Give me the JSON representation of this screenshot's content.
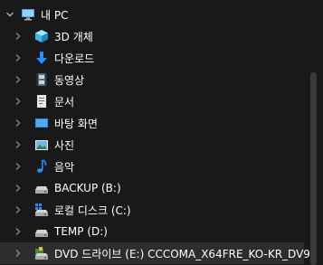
{
  "tree": {
    "root": {
      "label": "내 PC",
      "icon": "this-pc-icon",
      "expanded": true
    },
    "items": [
      {
        "label": "3D 개체",
        "icon": "3d-objects-icon"
      },
      {
        "label": "다운로드",
        "icon": "downloads-icon"
      },
      {
        "label": "동영상",
        "icon": "videos-icon"
      },
      {
        "label": "문서",
        "icon": "documents-icon"
      },
      {
        "label": "바탕 화면",
        "icon": "desktop-icon"
      },
      {
        "label": "사진",
        "icon": "pictures-icon"
      },
      {
        "label": "음악",
        "icon": "music-icon"
      },
      {
        "label": "BACKUP (B:)",
        "icon": "drive-icon"
      },
      {
        "label": "로컬 디스크 (C:)",
        "icon": "windows-drive-icon"
      },
      {
        "label": "TEMP (D:)",
        "icon": "drive-icon"
      },
      {
        "label": "DVD 드라이브 (E:) CCCOMA_X64FRE_KO-KR_DV9",
        "icon": "dvd-drive-icon",
        "selected": true
      }
    ]
  },
  "colors": {
    "background": "#191919",
    "selected_row": "#2d2d2d",
    "text": "#ffffff",
    "chevron": "#9a9a9a",
    "scrollbar_thumb": "#3a3a3a",
    "accent_blue": "#1e90ff"
  }
}
